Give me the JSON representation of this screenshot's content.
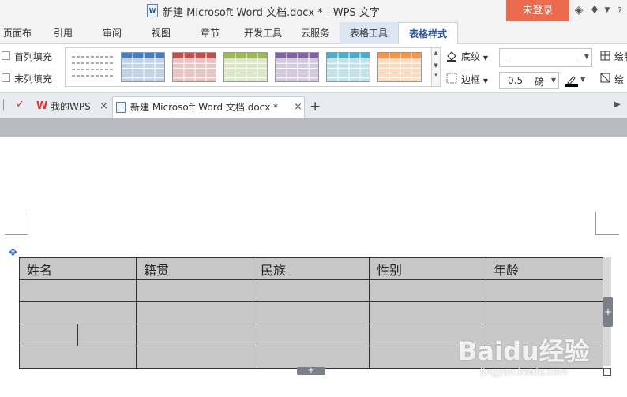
{
  "titlebar": {
    "title": "新建 Microsoft Word 文档.docx * - WPS 文字",
    "login_label": "未登录"
  },
  "ribbon_tabs": [
    {
      "label": "页面布局"
    },
    {
      "label": "引用"
    },
    {
      "label": "审阅"
    },
    {
      "label": "视图"
    },
    {
      "label": "章节"
    },
    {
      "label": "开发工具"
    },
    {
      "label": "云服务"
    },
    {
      "label": "表格工具"
    },
    {
      "label": "表格样式"
    }
  ],
  "ribbon": {
    "first_col_fill": "首列填充",
    "last_col_fill": "末列填充",
    "shading_label": "底纹",
    "border_label": "边框",
    "line_width_value": "0.5",
    "line_width_unit": "磅",
    "draw_table_label": "绘制",
    "eraser_label": "绘",
    "style_colors": [
      "#4a7ebb",
      "#c0504d",
      "#9bbb59",
      "#8064a2",
      "#4bacc6",
      "#f79646"
    ]
  },
  "doc_tabs": [
    {
      "label": "我的WPS"
    },
    {
      "label": "新建 Microsoft Word 文档.docx *"
    }
  ],
  "table": {
    "headers": [
      "姓名",
      "籍贯",
      "民族",
      "性别",
      "年龄"
    ]
  },
  "watermark": {
    "brand": "Baidu经验",
    "url": "jingyan.baidu.com"
  }
}
